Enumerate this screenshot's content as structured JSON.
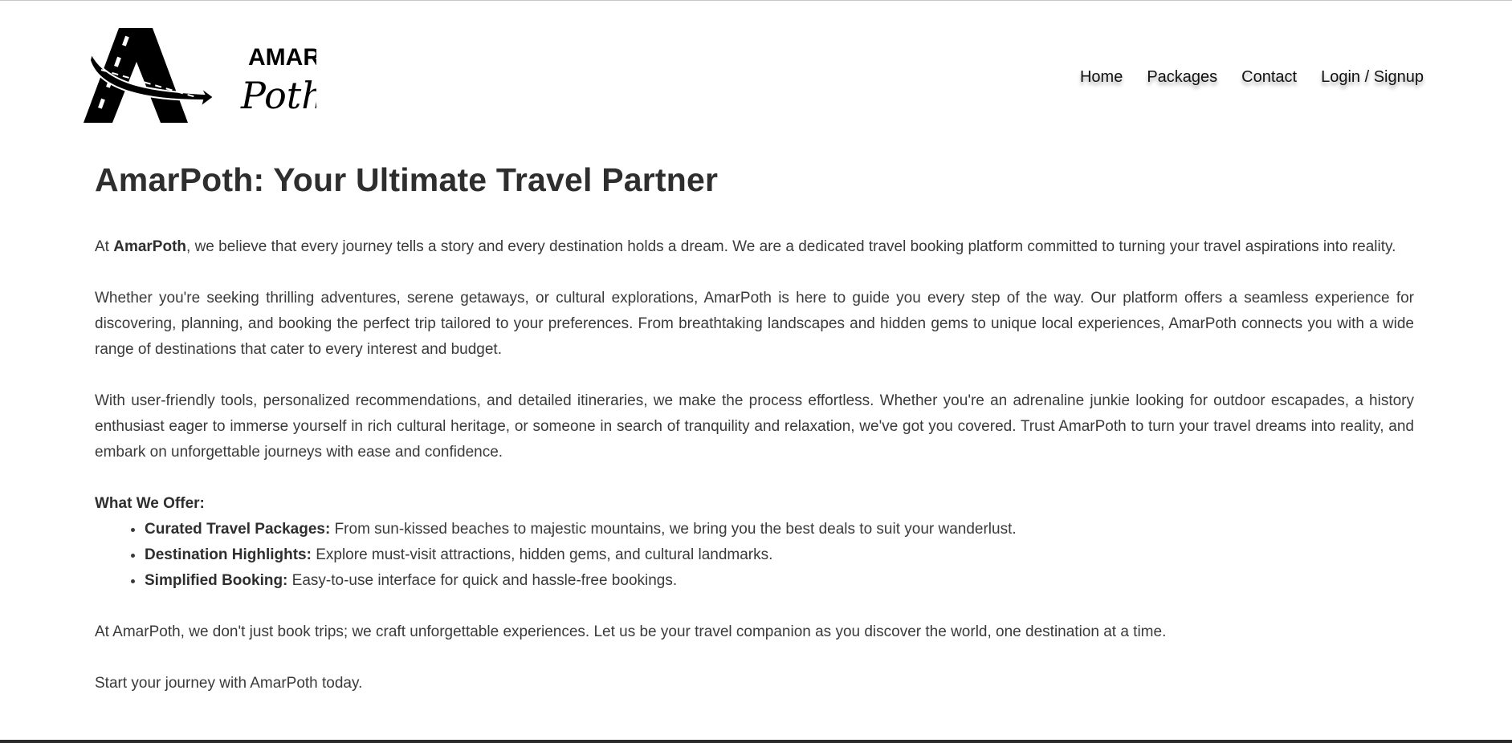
{
  "logo": {
    "line1": "AMAR",
    "line2": "Poth"
  },
  "nav": {
    "items": [
      {
        "label": "Home",
        "name": "nav-home"
      },
      {
        "label": "Packages",
        "name": "nav-packages"
      },
      {
        "label": "Contact",
        "name": "nav-contact"
      },
      {
        "label": "Login / Signup",
        "name": "nav-login-signup"
      }
    ]
  },
  "main": {
    "title": "AmarPoth: Your Ultimate Travel Partner",
    "intro": {
      "prefix": "At ",
      "brand": "AmarPoth",
      "suffix": ", we believe that every journey tells a story and every destination holds a dream. We are a dedicated travel booking platform committed to turning your travel aspirations into reality."
    },
    "paragraph2": "Whether you're seeking thrilling adventures, serene getaways, or cultural explorations, AmarPoth is here to guide you every step of the way. Our platform offers a seamless experience for discovering, planning, and booking the perfect trip tailored to your preferences. From breathtaking landscapes and hidden gems to unique local experiences, AmarPoth connects you with a wide range of destinations that cater to every interest and budget.",
    "paragraph3": "With user-friendly tools, personalized recommendations, and detailed itineraries, we make the process effortless. Whether you're an adrenaline junkie looking for outdoor escapades, a history enthusiast eager to immerse yourself in rich cultural heritage, or someone in search of tranquility and relaxation, we've got you covered. Trust AmarPoth to turn your travel dreams into reality, and embark on unforgettable journeys with ease and confidence.",
    "offer_title": "What We Offer:",
    "offers": [
      {
        "label": "Curated Travel Packages:",
        "text": " From sun-kissed beaches to majestic mountains, we bring you the best deals to suit your wanderlust."
      },
      {
        "label": "Destination Highlights:",
        "text": " Explore must-visit attractions, hidden gems, and cultural landmarks."
      },
      {
        "label": "Simplified Booking:",
        "text": " Easy-to-use interface for quick and hassle-free bookings."
      }
    ],
    "closing1": "At AmarPoth, we don't just book trips; we craft unforgettable experiences. Let us be your travel companion as you discover the world, one destination at a time.",
    "closing2": "Start your journey with AmarPoth today."
  }
}
